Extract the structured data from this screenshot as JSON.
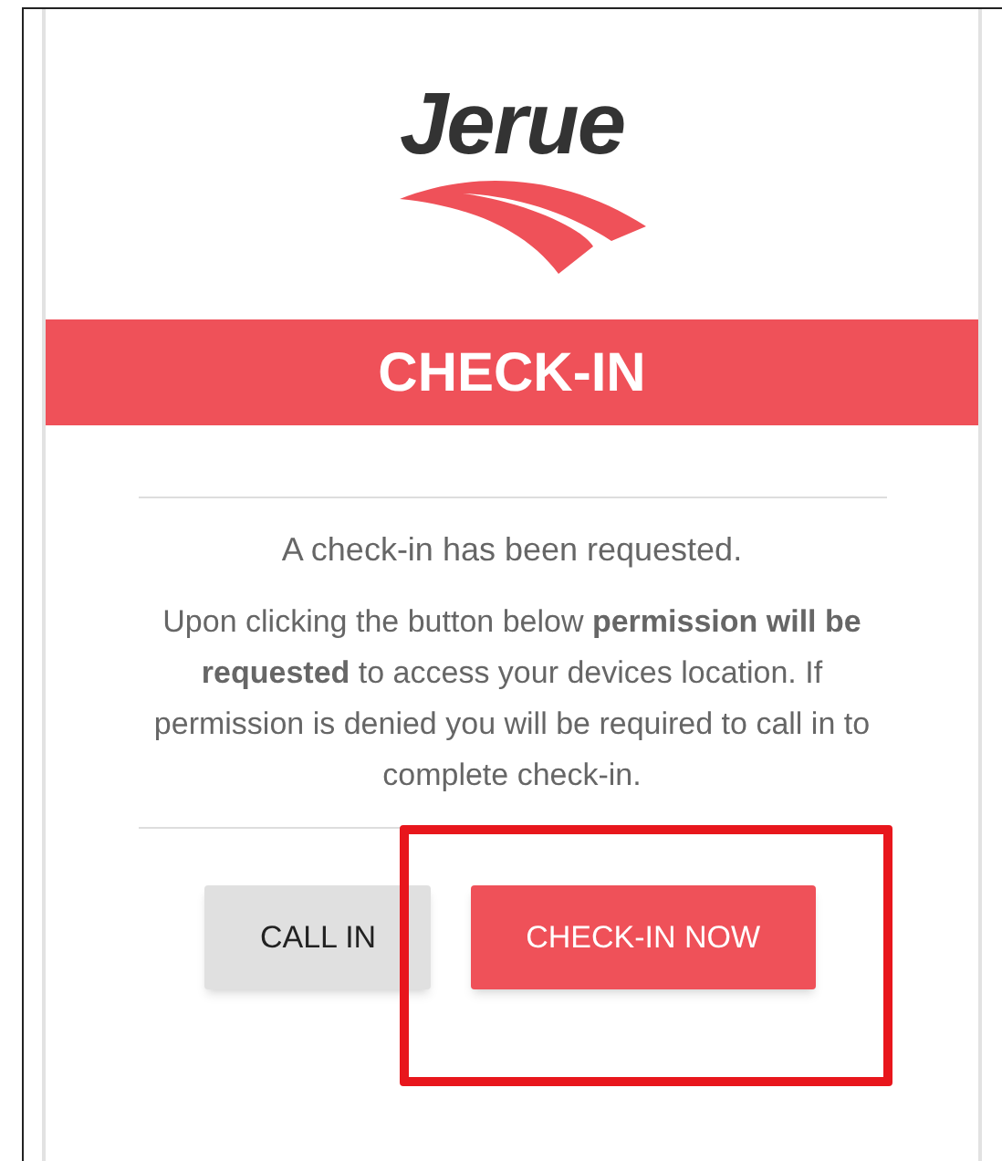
{
  "logo": {
    "text": "Jerue"
  },
  "banner": {
    "title": "CHECK-IN"
  },
  "message": "A check-in has been requested.",
  "details": "Upon clicking the button below **permission will be requested** to access your devices location. If permission is denied you will be required to call in to complete check-in.",
  "buttons": [
    {
      "label": "CALL IN",
      "kind": "secondary",
      "highlighted": false
    },
    {
      "label": "CHECK-IN NOW",
      "kind": "primary",
      "highlighted": true
    }
  ]
}
